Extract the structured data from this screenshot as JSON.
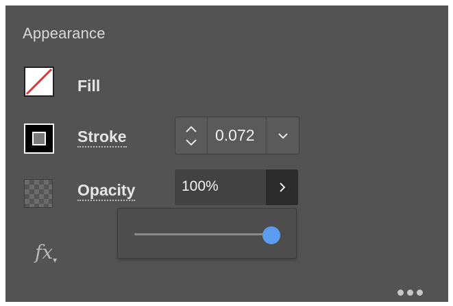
{
  "panel": {
    "title": "Appearance",
    "fill": {
      "label": "Fill"
    },
    "stroke": {
      "label": "Stroke",
      "value": "0.072"
    },
    "opacity": {
      "label": "Opacity",
      "value": "100%",
      "slider_fraction": 1.0
    },
    "fx_label": "fx"
  },
  "colors": {
    "panel_bg": "#535353",
    "slider_thumb": "#5b9cf0",
    "fill_none_slash": "#e0332d"
  },
  "icons": [
    "fill-none-swatch-icon",
    "stroke-swatch-icon",
    "opacity-checker-icon",
    "stepper-up-icon",
    "stepper-down-icon",
    "chevron-down-icon",
    "chevron-right-icon",
    "fx-icon",
    "more-options-icon"
  ]
}
